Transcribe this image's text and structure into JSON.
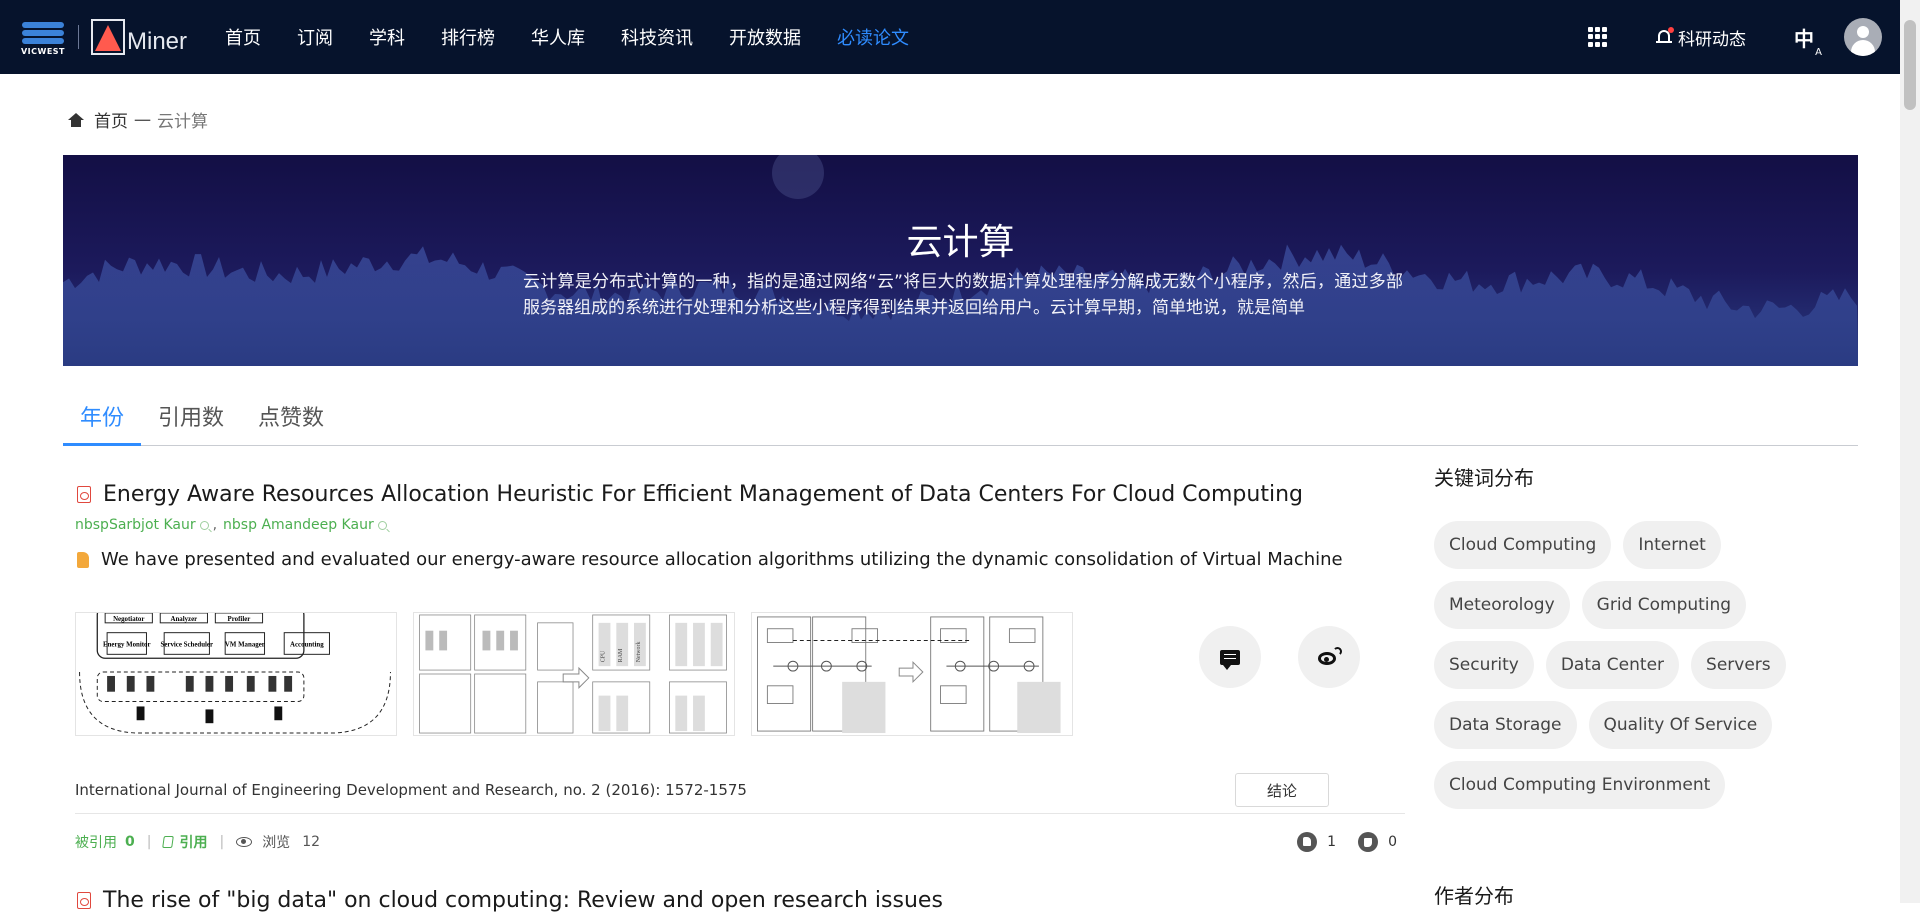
{
  "header": {
    "brand_small": "VICWEST",
    "brand": "Miner",
    "nav": [
      {
        "label": "首页"
      },
      {
        "label": "订阅"
      },
      {
        "label": "学科"
      },
      {
        "label": "排行榜"
      },
      {
        "label": "华人库"
      },
      {
        "label": "科技资讯"
      },
      {
        "label": "开放数据"
      },
      {
        "label": "必读论文",
        "active": true
      }
    ],
    "notifications_label": "科研动态",
    "lang_label": "中",
    "lang_sub": "A"
  },
  "breadcrumb": {
    "home": "首页",
    "separator": "一",
    "current": "云计算"
  },
  "banner": {
    "title": "云计算",
    "description": "云计算是分布式计算的一种，指的是通过网络“云”将巨大的数据计算处理程序分解成无数个小程序，然后，通过多部服务器组成的系统进行处理和分析这些小程序得到结果并返回给用户。云计算早期，简单地说，就是简单"
  },
  "tabs": [
    {
      "label": "年份",
      "active": true
    },
    {
      "label": "引用数"
    },
    {
      "label": "点赞数"
    }
  ],
  "paper": {
    "title": "Energy Aware Resources Allocation Heuristic For Efficient Management of Data Centers For Cloud Computing",
    "authors": [
      "nbspSarbjot Kaur",
      "nbsp Amandeep Kaur"
    ],
    "author_separator": ",",
    "abstract": "We have presented and evaluated our energy-aware resource allocation algorithms utilizing the dynamic consolidation of Virtual Machine",
    "figure_labels": {
      "fig1": [
        "Negotiator",
        "Analyzer",
        "Profiler",
        "Energy Monitor",
        "Service Scheduler",
        "VM Manager",
        "Accounting"
      ],
      "fig2": [
        "CPU",
        "RAM",
        "Network"
      ]
    },
    "venue": "International Journal of Engineering Development and Research, no. 2 (2016): 1572-1575",
    "conclusion_label": "结论",
    "cited_label": "被引用",
    "cited_count": "0",
    "cite_label": "引用",
    "views_label": "浏览",
    "views_count": "12",
    "likes": "1",
    "dislikes": "0"
  },
  "paper2": {
    "title": "The rise of \"big data\" on cloud computing: Review and open research issues"
  },
  "sidebar": {
    "keywords_heading": "关键词分布",
    "keywords": [
      "Cloud Computing",
      "Internet",
      "Meteorology",
      "Grid Computing",
      "Security",
      "Data Center",
      "Servers",
      "Data Storage",
      "Quality Of Service",
      "Cloud Computing Environment"
    ],
    "authors_heading": "作者分布"
  },
  "colors": {
    "nav_bg": "#06132c",
    "accent": "#2f8cff",
    "author_green": "#4caf50",
    "banner_top": "#130f45",
    "banner_bottom": "#2a3b82"
  }
}
